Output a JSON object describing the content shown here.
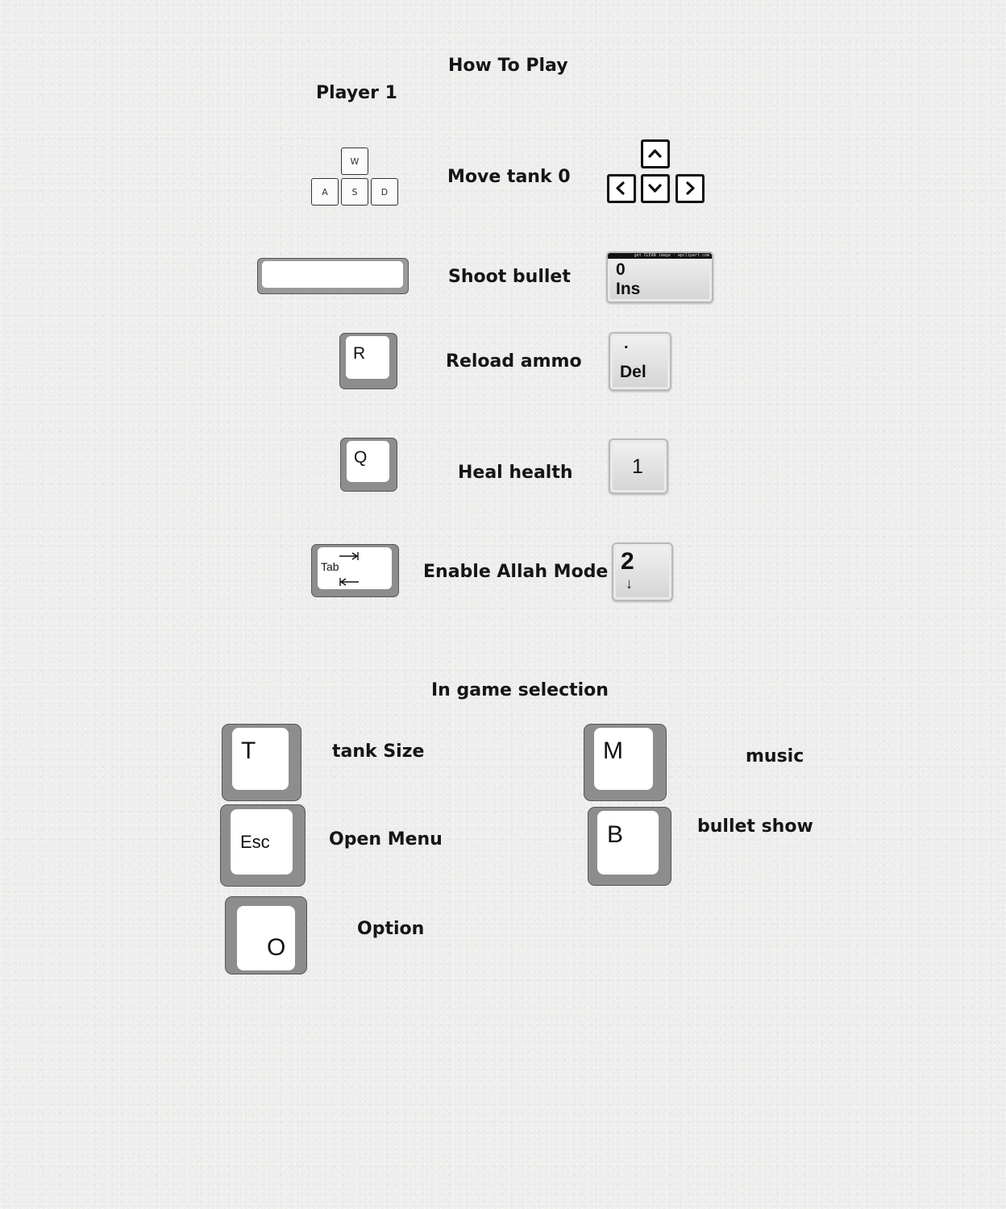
{
  "title": "How To Play",
  "player_label": "Player 1",
  "rows": [
    {
      "action": "Move tank 0"
    },
    {
      "action": "Shoot bullet"
    },
    {
      "action": "Reload ammo"
    },
    {
      "action": "Heal health"
    },
    {
      "action": "Enable Allah Mode"
    }
  ],
  "keys": {
    "wasd": {
      "w": "W",
      "a": "A",
      "s": "S",
      "d": "D"
    },
    "reload_left": "R",
    "heal_left": "Q",
    "tab": "Tab",
    "ins_top": "0",
    "ins_bottom": "Ins",
    "ins_strip": "get CLEAN image · wpclipart.com",
    "del_top": ".",
    "del_bottom": "Del",
    "heal_right": "1",
    "allah_right_top": "2",
    "allah_right_arrow": "↓"
  },
  "section2_title": "In game selection",
  "selection": [
    {
      "key": "T",
      "label": "tank Size"
    },
    {
      "key": "Esc",
      "label": "Open Menu"
    },
    {
      "key": "O",
      "label": "Option"
    },
    {
      "key": "M",
      "label": "music"
    },
    {
      "key": "B",
      "label": "bullet show"
    }
  ],
  "icons": [
    "arrow-up-icon",
    "arrow-down-icon",
    "arrow-left-icon",
    "arrow-right-icon",
    "tab-arrows-icon"
  ]
}
